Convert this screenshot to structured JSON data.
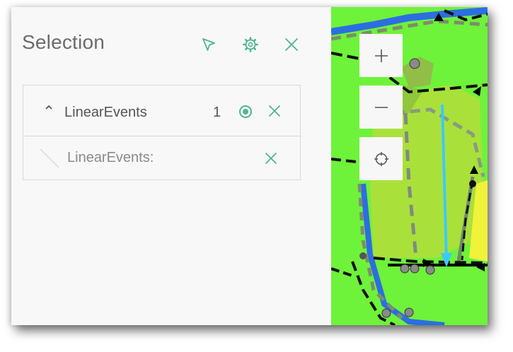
{
  "panel": {
    "title": "Selection",
    "header_buttons": [
      "select-arrow-icon",
      "gear-icon",
      "close-icon"
    ]
  },
  "selection_list": {
    "layer": {
      "name": "LinearEvents",
      "count": "1"
    },
    "feature": {
      "name": "LinearEvents:"
    }
  },
  "map_controls": [
    "zoom-in-icon",
    "zoom-out-icon",
    "locate-icon"
  ],
  "colors": {
    "accent": "#4fb58c",
    "panel_bg": "#f8f8f8",
    "map_green": "#6ef23a",
    "text": "#555555"
  }
}
